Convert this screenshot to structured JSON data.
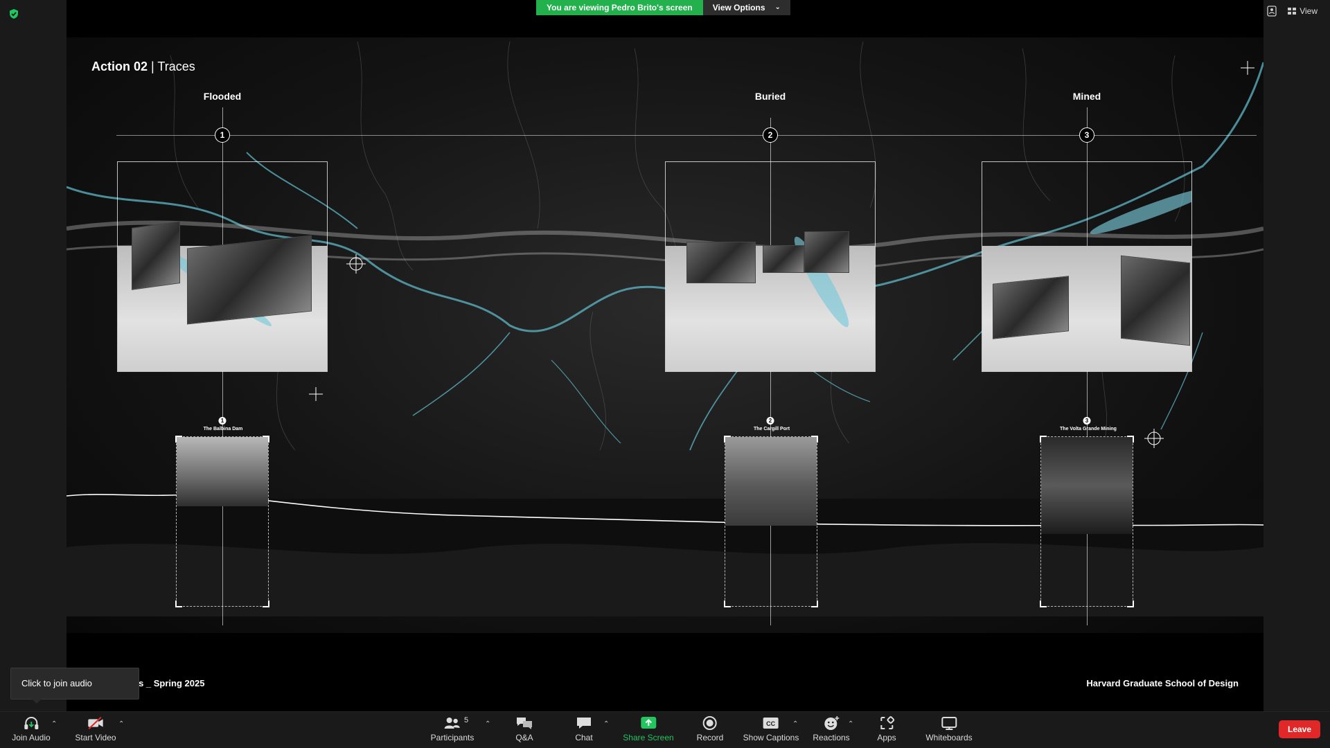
{
  "share_banner": {
    "message": "You are viewing Pedro Brito's screen",
    "view_options": "View Options"
  },
  "top_right": {
    "view_label": "View"
  },
  "slide": {
    "title_bold": "Action 02",
    "title_rest": " | Traces",
    "columns": [
      {
        "heading": "Flooded",
        "number": "1",
        "caption": "The Balbina Dam"
      },
      {
        "heading": "Buried",
        "number": "2",
        "caption": "The Cargill Port"
      },
      {
        "heading": "Mined",
        "number": "3",
        "caption": "The Volta Grande Mining"
      }
    ],
    "footer_left": "esis _ Spring 2025",
    "footer_right": "Harvard Graduate School of Design"
  },
  "tooltip": {
    "text": "Click to join audio"
  },
  "toolbar": {
    "join_audio": "Join Audio",
    "start_video": "Start Video",
    "participants": "Participants",
    "participants_count": "5",
    "qa": "Q&A",
    "chat": "Chat",
    "share_screen": "Share Screen",
    "record": "Record",
    "show_captions": "Show Captions",
    "captions_badge": "CC",
    "reactions": "Reactions",
    "apps": "Apps",
    "whiteboards": "Whiteboards",
    "leave": "Leave"
  },
  "colors": {
    "banner_green": "#22b14c",
    "leave_red": "#e02828",
    "share_green": "#22c55e",
    "river_cyan": "#5fb8c8"
  }
}
